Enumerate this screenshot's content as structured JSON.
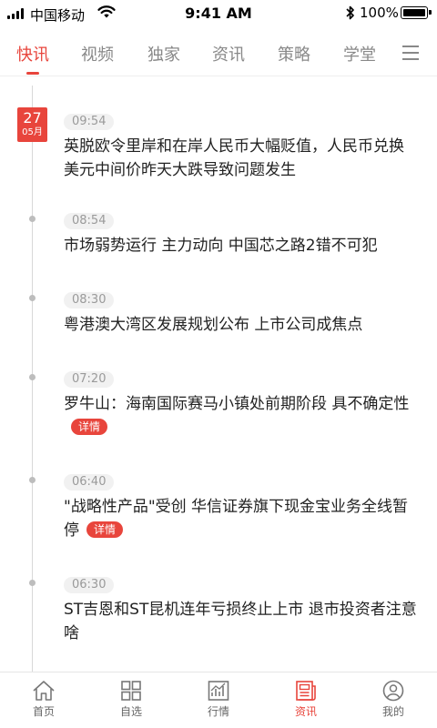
{
  "status_bar": {
    "carrier": "中国移动",
    "time": "9:41 AM",
    "battery": "100%"
  },
  "tabs": [
    {
      "label": "快讯",
      "active": true
    },
    {
      "label": "视频",
      "active": false
    },
    {
      "label": "独家",
      "active": false
    },
    {
      "label": "资讯",
      "active": false
    },
    {
      "label": "策略",
      "active": false
    },
    {
      "label": "学堂",
      "active": false
    }
  ],
  "date_badge": {
    "day": "27",
    "month": "05月"
  },
  "news": [
    {
      "time": "09:54",
      "text": "英脱欧令里岸和在岸人民币大幅贬值，人民币兑换美元中间价昨天大跌导致问题发生"
    },
    {
      "time": "08:54",
      "text": "市场弱势运行 主力动向 中国芯之路2错不可犯"
    },
    {
      "time": "08:30",
      "text": "粤港澳大湾区发展规划公布 上市公司成焦点"
    },
    {
      "time": "07:20",
      "text": "罗牛山：海南国际赛马小镇处前期阶段  具不确定性",
      "tag": "详情"
    },
    {
      "time": "06:40",
      "text": "\"战略性产品\"受创  华信证券旗下现金宝业务全线暂停",
      "tag": "详情"
    },
    {
      "time": "06:30",
      "text": "ST吉恩和ST昆机连年亏损终止上市 退市投资者注意啥"
    }
  ],
  "bottom_nav": [
    {
      "label": "首页",
      "icon": "home-icon",
      "active": false
    },
    {
      "label": "自选",
      "icon": "grid-icon",
      "active": false
    },
    {
      "label": "行情",
      "icon": "chart-icon",
      "active": false
    },
    {
      "label": "资讯",
      "icon": "newspaper-icon",
      "active": true
    },
    {
      "label": "我的",
      "icon": "user-icon",
      "active": false
    }
  ],
  "colors": {
    "accent": "#e8453c",
    "inactive_text": "#888888",
    "timeline_line": "#d8d8d8"
  }
}
